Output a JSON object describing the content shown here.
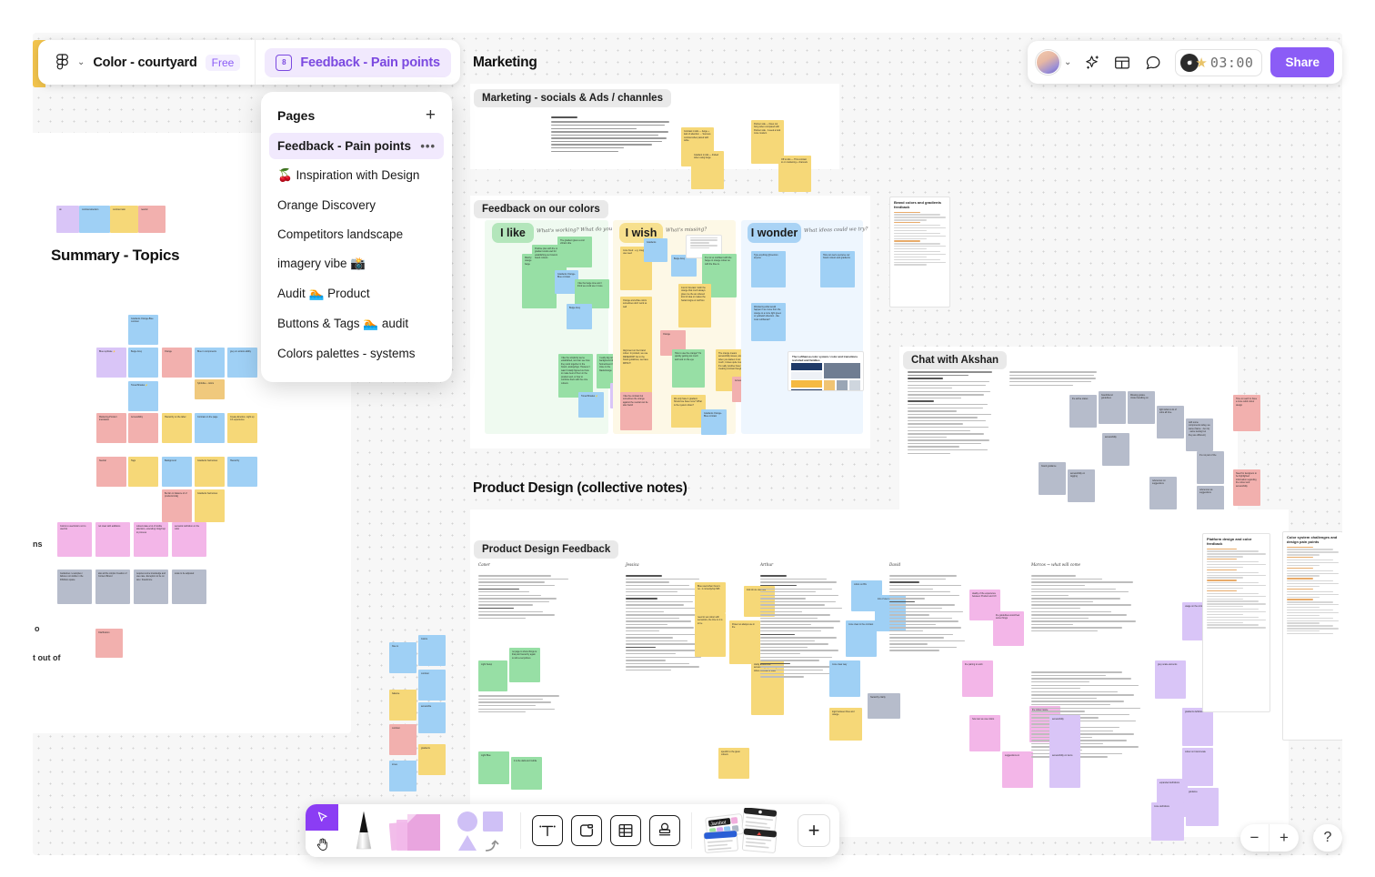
{
  "header": {
    "logo_icon": "figma-logo-icon",
    "chevron_icon": "chevron-down-icon",
    "doc_title": "Color - courtyard",
    "plan_badge": "Free",
    "page_chip": {
      "count": "8",
      "label": "Feedback - Pain points",
      "icon": "pages-stack-icon"
    }
  },
  "pages_menu": {
    "title": "Pages",
    "add_icon": "plus-icon",
    "more_icon": "ellipsis-icon",
    "items": [
      {
        "label": "Feedback - Pain points",
        "active": true
      },
      {
        "label": "🍒 Inspiration with Design",
        "active": false
      },
      {
        "label": "Orange Discovery",
        "active": false
      },
      {
        "label": "Competitors landscape",
        "active": false
      },
      {
        "label": "imagery vibe 📸",
        "active": false
      },
      {
        "label": "Audit 🏊 Product",
        "active": false
      },
      {
        "label": "Buttons & Tags 🏊  audit",
        "active": false
      },
      {
        "label": "Colors palettes - systems",
        "active": false
      }
    ]
  },
  "toolbar_right": {
    "avatar_name": "avatar",
    "chevron_icon": "chevron-down-icon",
    "ai_icon": "sparkle-ai-icon",
    "layout_icon": "layout-grid-icon",
    "comment_icon": "comment-bubble-icon",
    "music_icon": "music-disc-icon",
    "star_icon": "star-icon",
    "timer_value": "03:00",
    "share_label": "Share"
  },
  "toolbar_bottom": {
    "cursor_icon": "cursor-arrow-icon",
    "hand_icon": "hand-icon",
    "pen_icon": "pencil-icon",
    "sticky_icon": "sticky-note-icon",
    "shapes_icon": "shapes-icon",
    "text_icon": "text-tool-icon",
    "section_icon": "section-tool-icon",
    "table_icon": "table-tool-icon",
    "stamp_icon": "stamp-tool-icon",
    "widgets_icon": "widgets-cards-icon",
    "widget_label": "Jambot",
    "plus_icon": "plus-icon"
  },
  "zoom_controls": {
    "zoom_out_icon": "minus-icon",
    "zoom_in_icon": "plus-icon",
    "help_label": "?"
  },
  "canvas": {
    "sections": [
      {
        "id": "marketing",
        "title": "Marketing"
      },
      {
        "id": "product_design",
        "title": "Product Design (collective notes)"
      }
    ],
    "frames": [
      {
        "id": "marketing_frame",
        "label": "Marketing - socials & Ads / channles"
      },
      {
        "id": "feedback_colors",
        "label": "Feedback on our colors"
      },
      {
        "id": "chat_akshan",
        "label": "Chat with Akshan"
      },
      {
        "id": "pd_feedback",
        "label": "Product Design Feedback"
      }
    ],
    "summary": {
      "title": "Summary - Topics"
    },
    "feedback_columns": [
      {
        "pill": "I like",
        "prompt": "What's working? What do you like?",
        "pill_bg": "#b3e6bb",
        "bg": "#effaf0"
      },
      {
        "pill": "I wish",
        "prompt": "What's missing?",
        "pill_bg": "#f7e08e",
        "bg": "#fdf8e6"
      },
      {
        "pill": "I wonder",
        "prompt": "What ideas could we try?",
        "pill_bg": "#a9d3f5",
        "bg": "#eef6fe"
      }
    ],
    "pd_authors": [
      "Caner",
      "Jessica",
      "Arthur",
      "David",
      "Marcos → what will come"
    ],
    "documents": [
      {
        "title": "Brand colors and gradients feedback"
      },
      {
        "title": "Platform design and color feedback"
      },
      {
        "title": "Color system challenges and design pain points"
      }
    ],
    "clipped_left_text": [
      "ns",
      "o",
      "t out of"
    ]
  },
  "colors": {
    "accent": "#8b5cf6",
    "accent_soft": "#f1e9fd",
    "yellow_edge": "#f2c44d",
    "note_yellow": "#f6d878",
    "note_green": "#97dfa5",
    "note_blue": "#9fd0f5",
    "note_pink": "#f2b0ae",
    "note_purple": "#d9c5f7",
    "note_magenta": "#f3b6e8",
    "note_grey": "#b6bccb",
    "canvas_bg": "#f7f7f7"
  }
}
